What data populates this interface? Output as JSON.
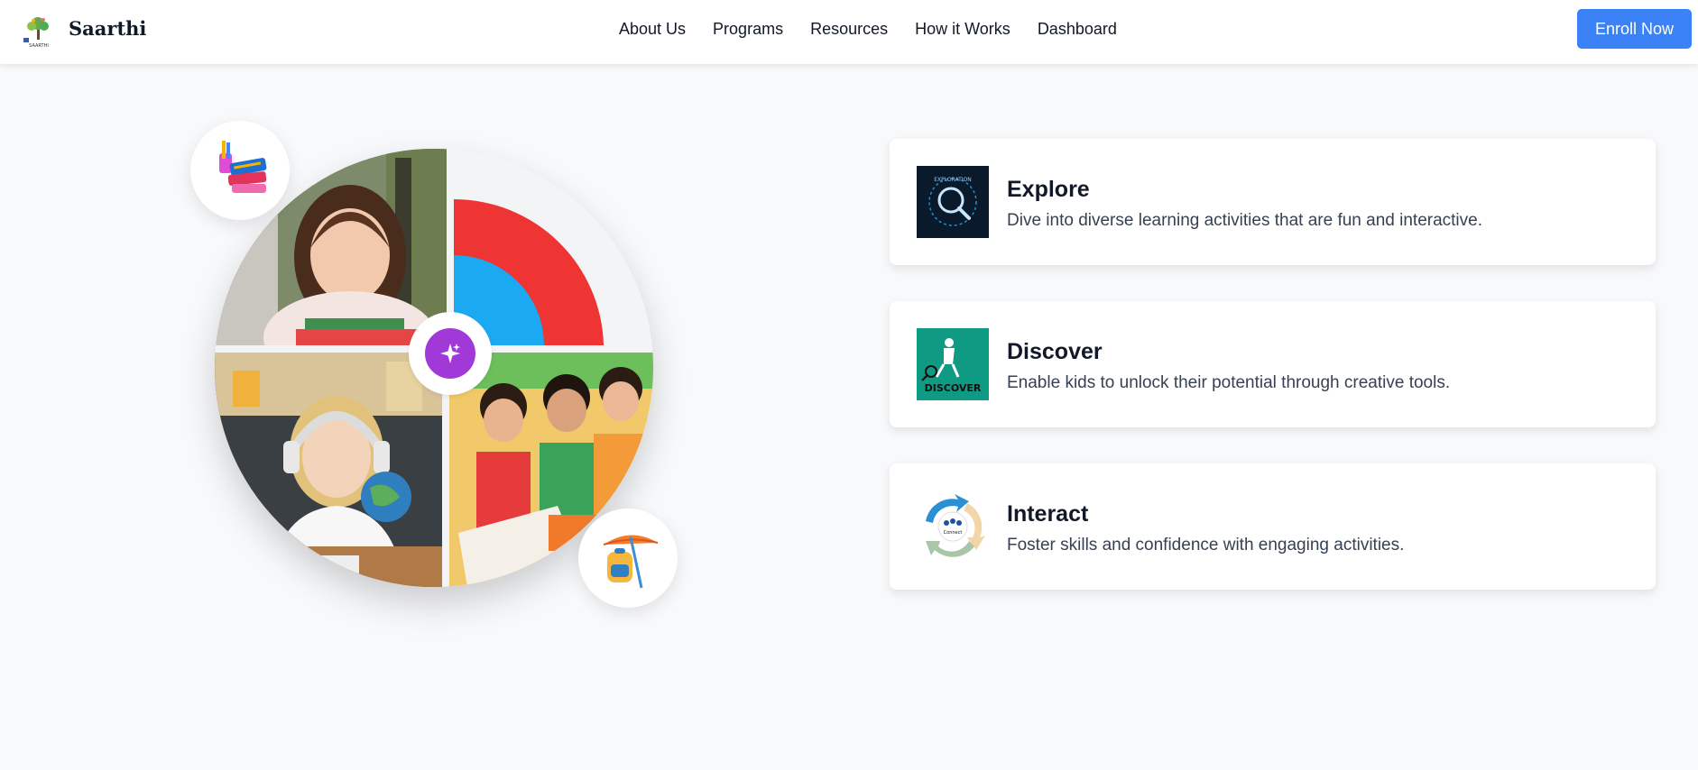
{
  "app": {
    "brand_name": "Saarthi",
    "logo_caption": "SAARTHI"
  },
  "nav": {
    "links": [
      "About Us",
      "Programs",
      "Resources",
      "How it Works",
      "Dashboard"
    ],
    "cta_label": "Enroll Now"
  },
  "colors": {
    "accent": "#3b82f6",
    "badge_purple": "#a139d9",
    "quad_red": "#ef3434",
    "quad_blue": "#1ba9f2",
    "discover_teal": "#0f9a84",
    "explore_navy": "#0a1a2b"
  },
  "hero": {
    "center_icon": "sparkle-icon",
    "top_left_icon": "books-icon",
    "bottom_right_icon": "backpack-icon"
  },
  "features": [
    {
      "title": "Explore",
      "description": "Dive into diverse learning activities that are fun and interactive.",
      "icon": "magnifier-icon",
      "icon_text": "EXPLORATION"
    },
    {
      "title": "Discover",
      "description": "Enable kids to unlock their potential through creative tools.",
      "icon": "discover-icon",
      "icon_text": "DISCOVER"
    },
    {
      "title": "Interact",
      "description": "Foster skills and confidence with engaging activities.",
      "icon": "connect-cycle-icon",
      "icon_text": "Connect"
    }
  ]
}
